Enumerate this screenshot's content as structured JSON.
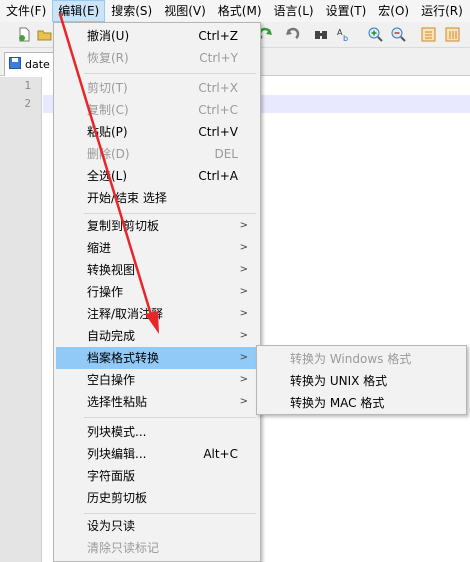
{
  "menubar": {
    "items": [
      "文件(F)",
      "编辑(E)",
      "搜索(S)",
      "视图(V)",
      "格式(M)",
      "语言(L)",
      "设置(T)",
      "宏(O)",
      "运行(R)"
    ]
  },
  "tab": {
    "label": "date"
  },
  "editor": {
    "lines": [
      "1",
      "2"
    ]
  },
  "edit_menu": {
    "undo": {
      "label": "撤消(U)",
      "shortcut": "Ctrl+Z"
    },
    "redo": {
      "label": "恢复(R)",
      "shortcut": "Ctrl+Y"
    },
    "cut": {
      "label": "剪切(T)",
      "shortcut": "Ctrl+X"
    },
    "copy": {
      "label": "复制(C)",
      "shortcut": "Ctrl+C"
    },
    "paste": {
      "label": "粘贴(P)",
      "shortcut": "Ctrl+V"
    },
    "delete": {
      "label": "删除(D)",
      "shortcut": "DEL"
    },
    "select_all": {
      "label": "全选(L)",
      "shortcut": "Ctrl+A"
    },
    "begin_end_select": {
      "label": "开始/结束 选择"
    },
    "copy_to_clipboard": {
      "label": "复制到剪切板"
    },
    "indent": {
      "label": "缩进"
    },
    "convert_case": {
      "label": "转换视图"
    },
    "line_ops": {
      "label": "行操作"
    },
    "comment": {
      "label": "注释/取消注释"
    },
    "auto_complete": {
      "label": "自动完成"
    },
    "eol_conversion": {
      "label": "档案格式转换"
    },
    "blank_ops": {
      "label": "空白操作"
    },
    "paste_special": {
      "label": "选择性粘贴"
    },
    "column_mode": {
      "label": "列块模式..."
    },
    "column_editor": {
      "label": "列块编辑...",
      "shortcut": "Alt+C"
    },
    "char_panel": {
      "label": "字符面版"
    },
    "clipboard_history": {
      "label": "历史剪切板"
    },
    "set_readonly": {
      "label": "设为只读"
    },
    "clear_readonly": {
      "label": "清除只读标记"
    }
  },
  "submenu": {
    "to_windows": "转换为 Windows 格式",
    "to_unix": "转换为 UNIX 格式",
    "to_mac": "转换为 MAC 格式"
  },
  "colors": {
    "highlight": "#91c9f7",
    "arrow": "#e8262a"
  }
}
